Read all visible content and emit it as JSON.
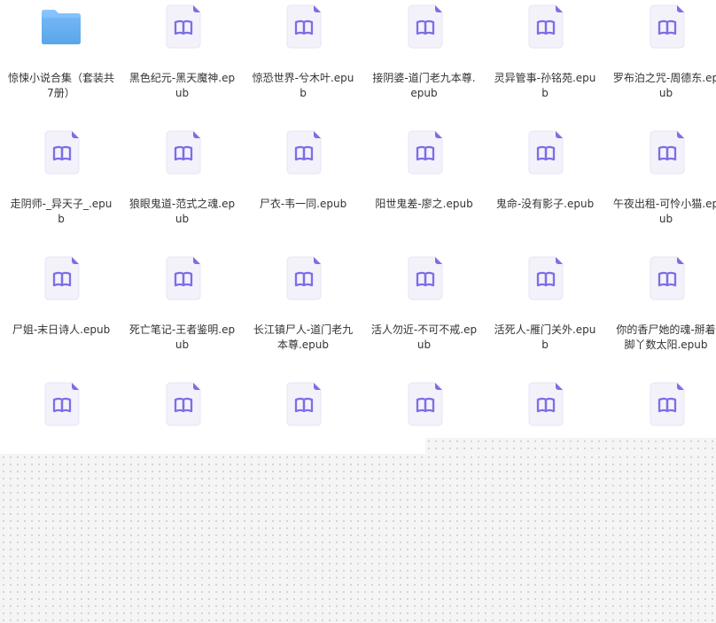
{
  "colors": {
    "accent": "#7c6ee6",
    "file_bg": "#f3f2fb",
    "file_fold": "#7c6ee6",
    "folder": "#5aa6ea",
    "text": "#333333"
  },
  "items": [
    {
      "name": "惊悚小说合集（套装共7册）",
      "icon": "folder-icon"
    },
    {
      "name": "黑色纪元-黑天魔神.epub",
      "icon": "epub-book-icon"
    },
    {
      "name": "惊恐世界-兮木叶.epub",
      "icon": "epub-book-icon"
    },
    {
      "name": "接阴婆-道门老九本尊.epub",
      "icon": "epub-book-icon"
    },
    {
      "name": "灵异管事-孙铭苑.epub",
      "icon": "epub-book-icon"
    },
    {
      "name": "罗布泊之咒-周德东.epub",
      "icon": "epub-book-icon"
    },
    {
      "name": "走阴师-_异天子_.epub",
      "icon": "epub-book-icon"
    },
    {
      "name": "狼眼鬼道-范式之魂.epub",
      "icon": "epub-book-icon"
    },
    {
      "name": "尸衣-韦一同.epub",
      "icon": "epub-book-icon"
    },
    {
      "name": "阳世鬼差-廖之.epub",
      "icon": "epub-book-icon"
    },
    {
      "name": "鬼命-没有影子.epub",
      "icon": "epub-book-icon"
    },
    {
      "name": "午夜出租-可怜小猫.epub",
      "icon": "epub-book-icon"
    },
    {
      "name": "尸姐-末日诗人.epub",
      "icon": "epub-book-icon"
    },
    {
      "name": "死亡笔记-王者鉴明.epub",
      "icon": "epub-book-icon"
    },
    {
      "name": "长江镇尸人-道门老九本尊.epub",
      "icon": "epub-book-icon"
    },
    {
      "name": "活人勿近-不可不戒.epub",
      "icon": "epub-book-icon"
    },
    {
      "name": "活死人-雁门关外.epub",
      "icon": "epub-book-icon"
    },
    {
      "name": "你的香尸她的魂-掰着脚丫数太阳.epub",
      "icon": "epub-book-icon"
    },
    {
      "name": "",
      "icon": "epub-book-icon"
    },
    {
      "name": "",
      "icon": "epub-book-icon"
    },
    {
      "name": "",
      "icon": "epub-book-icon"
    },
    {
      "name": "",
      "icon": "epub-book-icon"
    },
    {
      "name": "",
      "icon": "epub-book-icon"
    },
    {
      "name": "",
      "icon": "epub-book-icon"
    }
  ]
}
